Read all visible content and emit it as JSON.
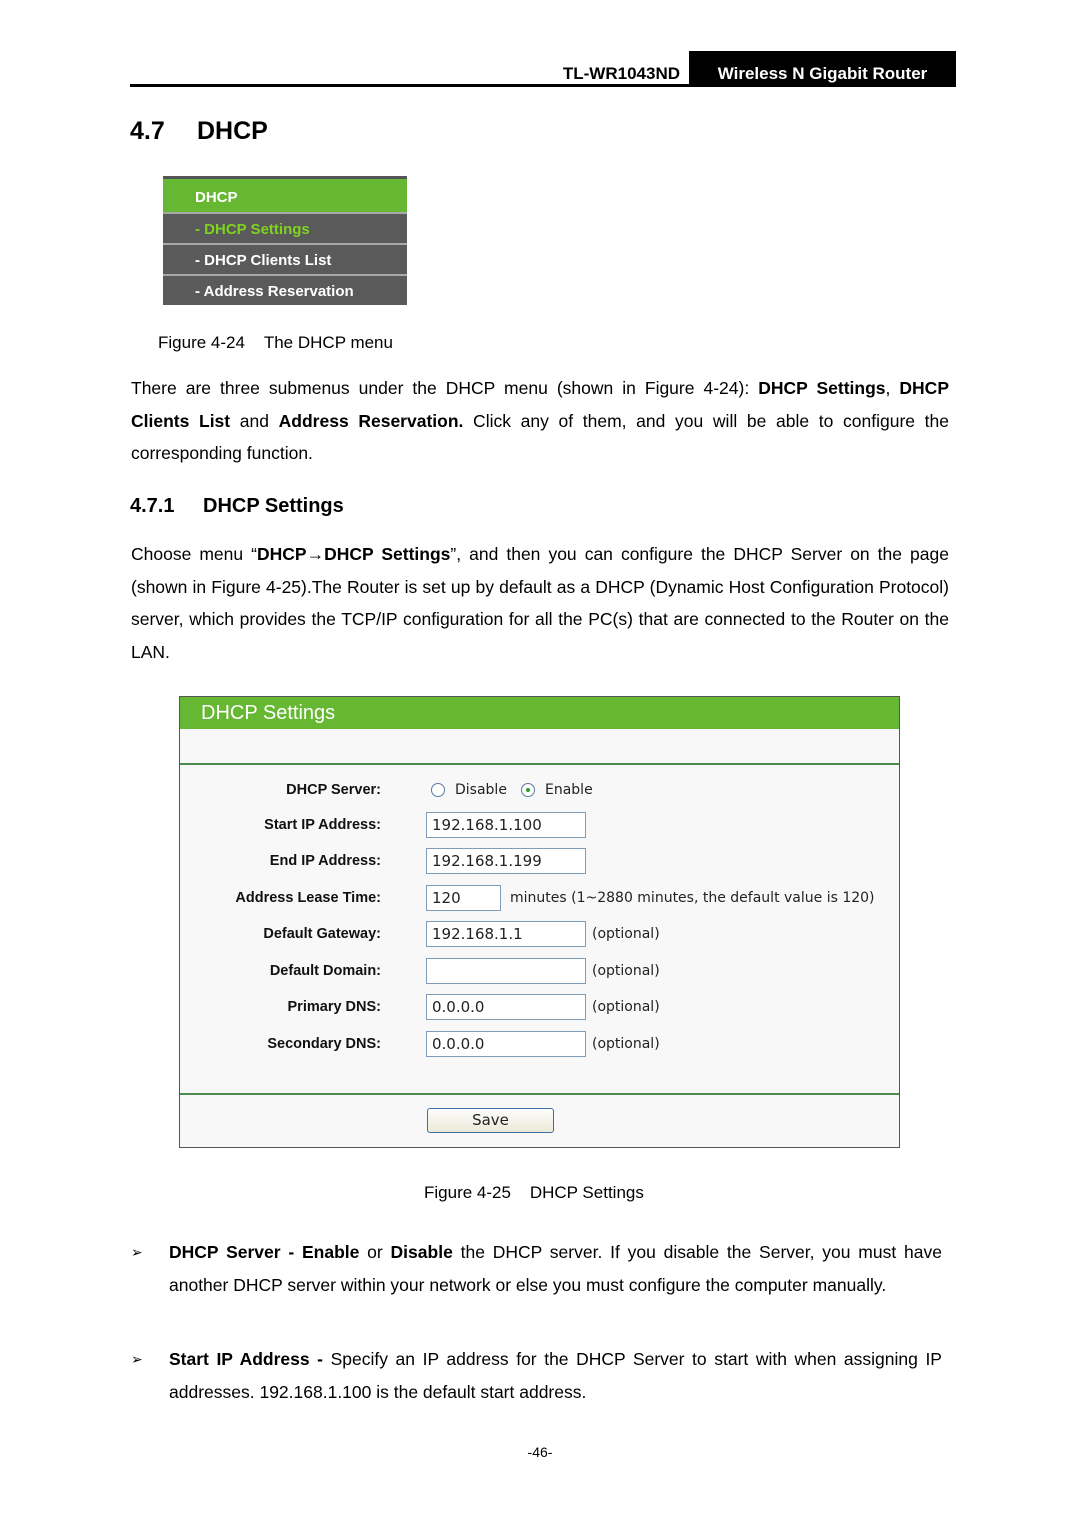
{
  "header": {
    "model": "TL-WR1043ND",
    "product": "Wireless N Gigabit Router"
  },
  "section": {
    "number": "4.7",
    "title": "DHCP"
  },
  "menu_figure": {
    "head": "DHCP",
    "items": [
      {
        "label": "- DHCP Settings",
        "active": true
      },
      {
        "label": "- DHCP Clients List",
        "active": false
      },
      {
        "label": "- Address Reservation",
        "active": false
      }
    ],
    "caption_num": "Figure 4-24",
    "caption_text": "The DHCP menu"
  },
  "intro": {
    "t1": "There are three submenus under the DHCP menu (shown in Figure 4-24): ",
    "b1": "DHCP Settings",
    "t2": ", ",
    "b2": "DHCP Clients List",
    "t3": " and ",
    "b3": "Address Reservation.",
    "t4": " Click any of them, and you will be able to configure the corresponding function."
  },
  "subsection": {
    "number": "4.7.1",
    "title": "DHCP Settings"
  },
  "choose": {
    "t1": "Choose menu “",
    "b1": "DHCP→DHCP Settings",
    "t2": "”, and then you can configure the DHCP Server on the page (shown in Figure 4-25).The Router is set up by default as a DHCP (Dynamic Host Configuration Protocol) server, which provides the TCP/IP configuration for all the PC(s) that are connected to the Router on the LAN."
  },
  "settings_panel": {
    "title": "DHCP Settings",
    "dhcp_server_label": "DHCP Server:",
    "disable_label": "Disable",
    "enable_label": "Enable",
    "selected": "Enable",
    "fields": [
      {
        "label": "Start IP Address:",
        "value": "192.168.1.100",
        "hint": ""
      },
      {
        "label": "End IP Address:",
        "value": "192.168.1.199",
        "hint": ""
      },
      {
        "label": "Address Lease Time:",
        "value": "120",
        "hint": "minutes (1~2880 minutes, the default value is 120)"
      },
      {
        "label": "Default Gateway:",
        "value": "192.168.1.1",
        "hint": "(optional)"
      },
      {
        "label": "Default Domain:",
        "value": "",
        "hint": "(optional)"
      },
      {
        "label": "Primary DNS:",
        "value": "0.0.0.0",
        "hint": "(optional)"
      },
      {
        "label": "Secondary DNS:",
        "value": "0.0.0.0",
        "hint": "(optional)"
      }
    ],
    "save_label": "Save",
    "caption_num": "Figure 4-25",
    "caption_text": "DHCP Settings"
  },
  "bullets": [
    {
      "mark": "➢",
      "b1": "DHCP Server - Enable",
      "t1": " or ",
      "b2": "Disable",
      "t2": " the DHCP server. If you disable the Server, you must have another DHCP server within your network or else you must configure the computer manually."
    },
    {
      "mark": "➢",
      "b1": "Start IP Address -",
      "t1": " Specify an IP address for the DHCP Server to start with when assigning IP addresses. 192.168.1.100 is the default start address."
    }
  ],
  "page_number": "-46-"
}
